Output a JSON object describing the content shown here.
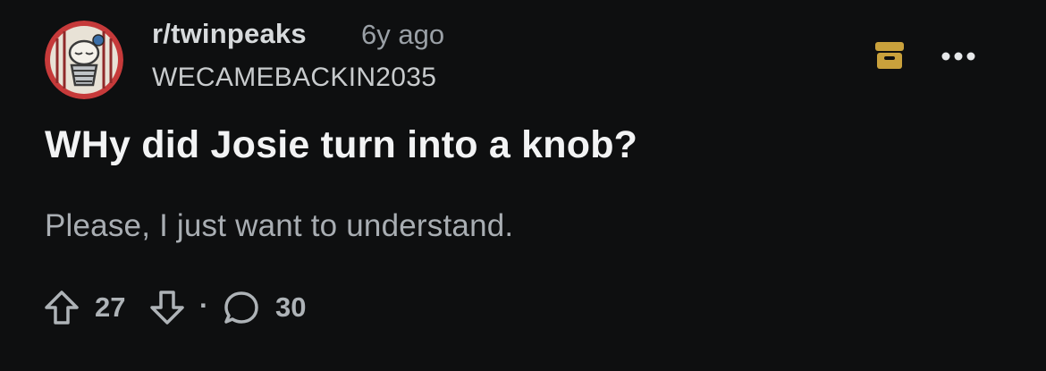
{
  "post": {
    "subreddit": "r/twinpeaks",
    "age": "6y ago",
    "author": "WECAMEBACKIN2035",
    "title": "WHy did Josie turn into a knob?",
    "body": "Please, I just want to understand.",
    "upvotes": "27",
    "separator": "·",
    "comments": "30"
  },
  "icons": {
    "avatar": "subreddit-avatar",
    "archive": "archive-icon",
    "more": "more-options-icon",
    "upvote": "upvote-arrow-icon",
    "downvote": "downvote-arrow-icon",
    "comment": "comment-bubble-icon"
  },
  "colors": {
    "background": "#0e0f10",
    "archive_accent": "#c9a13c",
    "avatar_ring": "#c63a3a"
  }
}
